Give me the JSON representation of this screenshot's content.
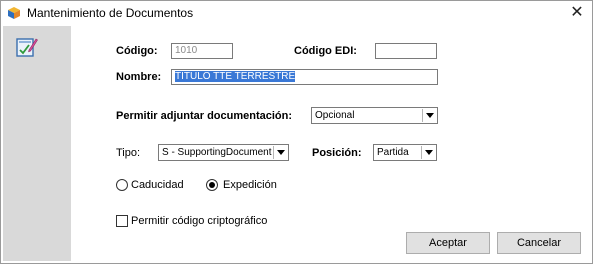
{
  "window": {
    "title": "Mantenimiento de Documentos",
    "close_glyph": "✕"
  },
  "form": {
    "codigo_label": "Código:",
    "codigo_value": "1010",
    "codigo_edi_label": "Código EDI:",
    "codigo_edi_value": "",
    "nombre_label": "Nombre:",
    "nombre_value": "TITULO TTE TERRESTRE",
    "adjuntar_label": "Permitir adjuntar documentación:",
    "adjuntar_value": "Opcional",
    "tipo_label": "Tipo:",
    "tipo_value": "S - SupportingDocument",
    "posicion_label": "Posición:",
    "posicion_value": "Partida",
    "radio_caducidad": "Caducidad",
    "radio_expedicion": "Expedición",
    "radio_selected": "Expedición",
    "checkbox_cripto": "Permitir código criptográfico",
    "checkbox_cripto_checked": false
  },
  "buttons": {
    "accept": "Aceptar",
    "cancel": "Cancelar"
  },
  "icons": {
    "app": "app-cube-icon",
    "document": "document-edit-icon",
    "close": "close-icon"
  }
}
